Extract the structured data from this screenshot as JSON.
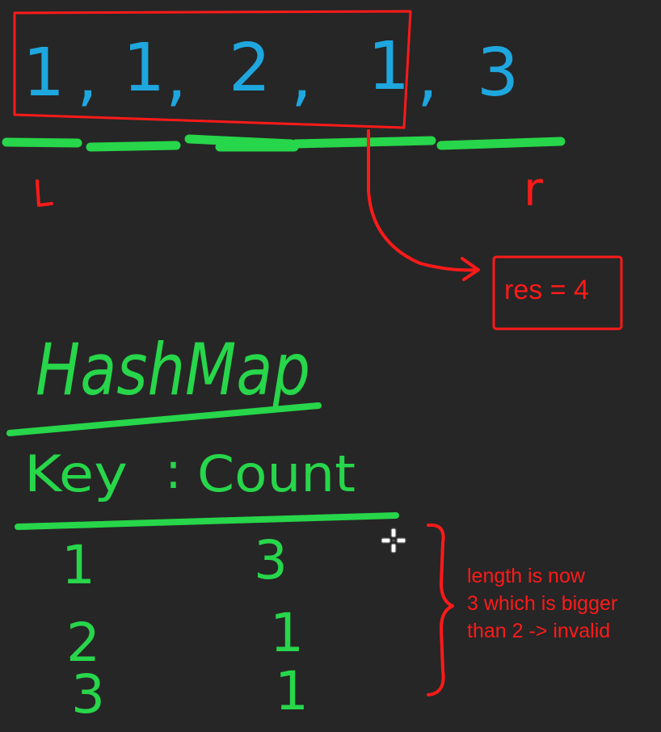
{
  "array": {
    "values": [
      "1",
      "1",
      "2",
      "1",
      "3"
    ],
    "separator": ",",
    "left_pointer_label": "L",
    "right_pointer_label": "r"
  },
  "result": {
    "text": "res = 4"
  },
  "hashmap": {
    "title": "HashMap",
    "key_header": "Key",
    "separator": ":",
    "count_header": "Count",
    "rows": [
      {
        "key": "1",
        "count": "3"
      },
      {
        "key": "2",
        "count": "1"
      },
      {
        "key": "3",
        "count": "1"
      }
    ]
  },
  "note": {
    "lines": [
      "length is now",
      "3 which is bigger",
      "than 2 -> invalid"
    ]
  },
  "colors": {
    "background": "#262626",
    "array_digits": "#1ea7de",
    "hand_green": "#27d64a",
    "annotation_red": "#ff1a1a"
  },
  "icons": {
    "cursor": "move-crosshair-icon"
  }
}
